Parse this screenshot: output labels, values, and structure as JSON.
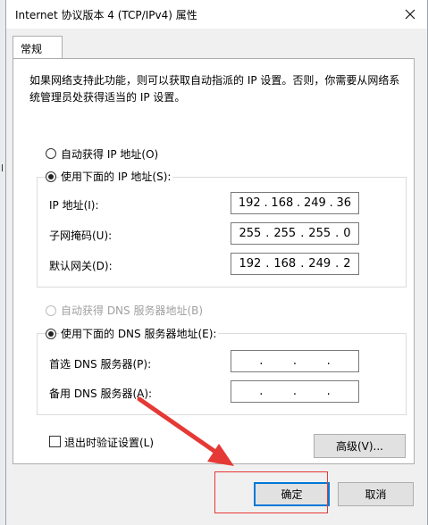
{
  "window": {
    "title": "Internet 协议版本 4 (TCP/IPv4) 属性"
  },
  "tabs": [
    {
      "label": "常规"
    }
  ],
  "description": "如果网络支持此功能，则可以获取自动指派的 IP 设置。否则，你需要从网络系统管理员处获得适当的 IP 设置。",
  "ip_section": {
    "auto_label": "自动获得 IP 地址(O)",
    "manual_label": "使用下面的 IP 地址(S):",
    "selected": "manual",
    "fields": [
      {
        "label": "IP 地址(I):",
        "octets": [
          "192",
          "168",
          "249",
          "36"
        ]
      },
      {
        "label": "子网掩码(U):",
        "octets": [
          "255",
          "255",
          "255",
          "0"
        ]
      },
      {
        "label": "默认网关(D):",
        "octets": [
          "192",
          "168",
          "249",
          "2"
        ]
      }
    ]
  },
  "dns_section": {
    "auto_label": "自动获得 DNS 服务器地址(B)",
    "manual_label": "使用下面的 DNS 服务器地址(E):",
    "selected": "manual",
    "fields": [
      {
        "label": "首选 DNS 服务器(P):",
        "octets": [
          "",
          "",
          "",
          ""
        ]
      },
      {
        "label": "备用 DNS 服务器(A):",
        "octets": [
          "",
          "",
          "",
          ""
        ]
      }
    ]
  },
  "validate_checkbox": {
    "label": "退出时验证设置(L)",
    "checked": false
  },
  "buttons": {
    "advanced": "高级(V)...",
    "ok": "确定",
    "cancel": "取消"
  },
  "icons": {
    "close": "close-icon",
    "annotation": "red-arrow-annotation"
  },
  "colors": {
    "annotation_red": "#e53935",
    "default_button_border": "#0078d7"
  }
}
